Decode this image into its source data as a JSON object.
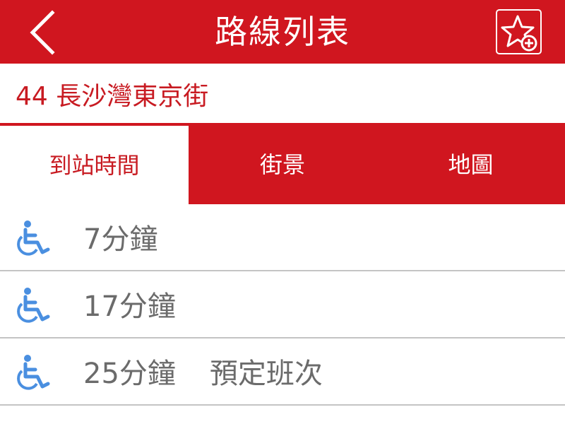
{
  "header": {
    "title": "路線列表",
    "back_icon": "chevron-left-icon",
    "favorite_icon": "star-plus-icon",
    "background_color": "#d0161f"
  },
  "route": {
    "name": "44 長沙灣東京街",
    "color": "#c81b22"
  },
  "tabs": [
    {
      "label": "到站時間",
      "active": true
    },
    {
      "label": "街景",
      "active": false
    },
    {
      "label": "地圖",
      "active": false
    }
  ],
  "arrivals": [
    {
      "eta": "7分鐘",
      "note": "",
      "accessible_icon": "wheelchair-icon"
    },
    {
      "eta": "17分鐘",
      "note": "",
      "accessible_icon": "wheelchair-icon"
    },
    {
      "eta": "25分鐘",
      "note": "預定班次",
      "accessible_icon": "wheelchair-icon"
    }
  ],
  "colors": {
    "accent_red": "#d0161f",
    "wheelchair_blue": "#4a8fe0",
    "eta_gray": "#6b6b6b"
  }
}
